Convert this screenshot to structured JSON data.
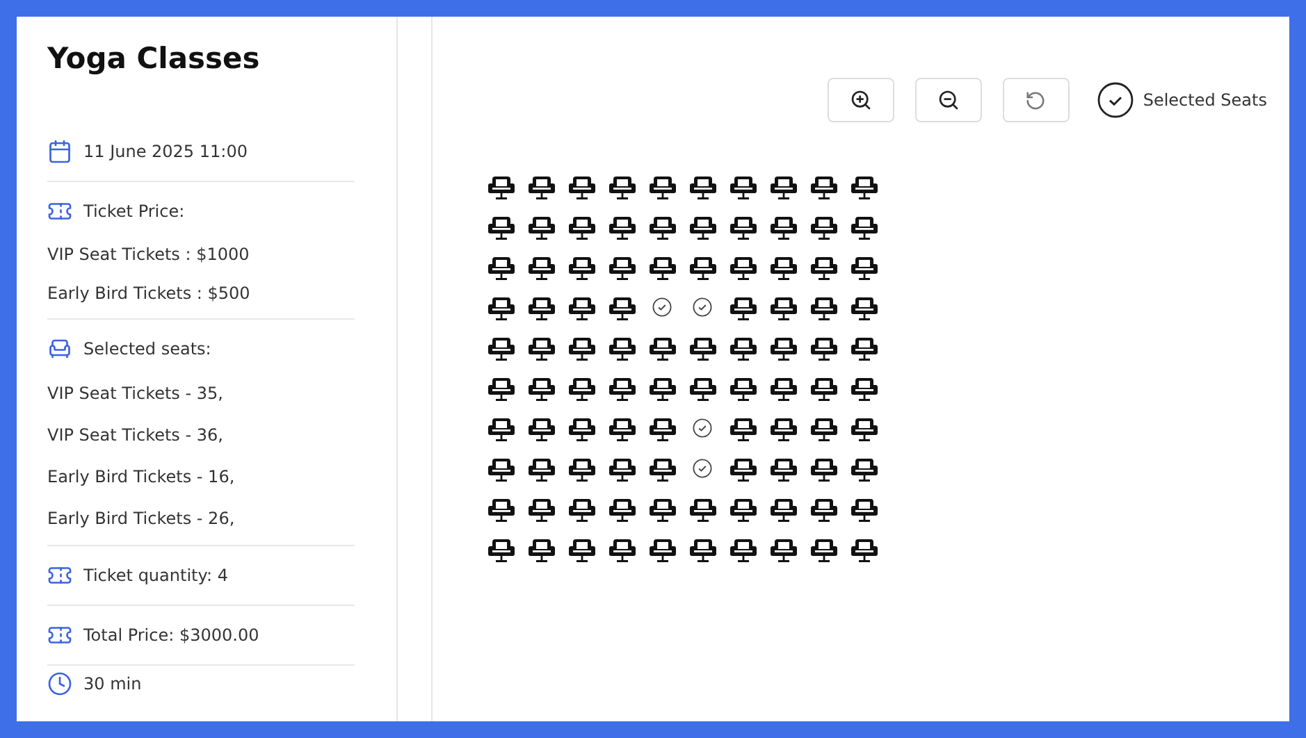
{
  "event": {
    "title": "Yoga Classes",
    "date": "11 June 2025  11:00"
  },
  "ticket_price": {
    "label": "Ticket Price:",
    "lines": [
      "VIP Seat Tickets : $1000",
      "Early Bird Tickets : $500"
    ]
  },
  "selected_seats": {
    "label": "Selected seats:",
    "lines": [
      "VIP Seat Tickets - 35,",
      "VIP Seat Tickets - 36,",
      "Early Bird Tickets - 16,",
      "Early Bird Tickets - 26,"
    ]
  },
  "quantity": "Ticket quantity:  4",
  "total": "Total Price:  $3000.00",
  "duration": "30 min",
  "legend": "Selected Seats",
  "sections": [
    {
      "rows": [
        [
          false,
          false,
          false,
          false,
          false,
          false,
          false,
          false,
          false,
          false
        ],
        [
          false,
          false,
          false,
          false,
          false,
          false,
          false,
          false,
          false,
          false
        ],
        [
          false,
          false,
          false,
          false,
          false,
          false,
          false,
          false,
          false,
          false
        ],
        [
          false,
          false,
          false,
          false,
          true,
          true,
          false,
          false,
          false,
          false
        ],
        [
          false,
          false,
          false,
          false,
          false,
          false,
          false,
          false,
          false,
          false
        ]
      ]
    },
    {
      "rows": [
        [
          false,
          false,
          false,
          false,
          false,
          false,
          false,
          false,
          false,
          false
        ],
        [
          false,
          false,
          false,
          false,
          false,
          true,
          false,
          false,
          false,
          false
        ],
        [
          false,
          false,
          false,
          false,
          false,
          true,
          false,
          false,
          false,
          false
        ],
        [
          false,
          false,
          false,
          false,
          false,
          false,
          false,
          false,
          false,
          false
        ],
        [
          false,
          false,
          false,
          false,
          false,
          false,
          false,
          false,
          false,
          false
        ]
      ]
    }
  ]
}
